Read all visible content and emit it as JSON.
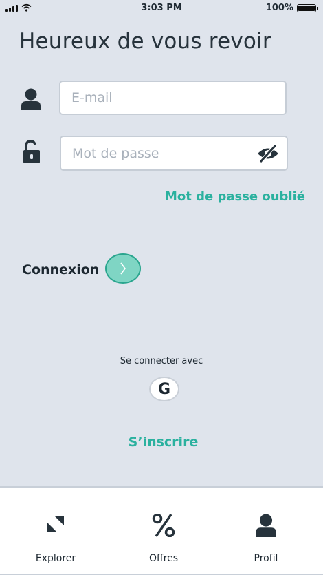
{
  "status_bar": {
    "time": "3:03 PM",
    "battery": "100%"
  },
  "login": {
    "title": "Heureux de vous revoir",
    "email_placeholder": "E-mail",
    "password_placeholder": "Mot de passe",
    "forgot_password": "Mot de passe oublié",
    "login_label": "Connexion",
    "connect_with": "Se connecter avec",
    "google_letter": "G",
    "signup": "S’inscrire"
  },
  "tabbar": {
    "items": [
      {
        "label": "Explorer",
        "icon": "explore-icon"
      },
      {
        "label": "Offres",
        "icon": "percent-icon"
      },
      {
        "label": "Profil",
        "icon": "profile-icon"
      }
    ]
  },
  "colors": {
    "accent": "#2bb19f",
    "button_fill": "#7fd5c4",
    "background": "#dfe4ec"
  }
}
